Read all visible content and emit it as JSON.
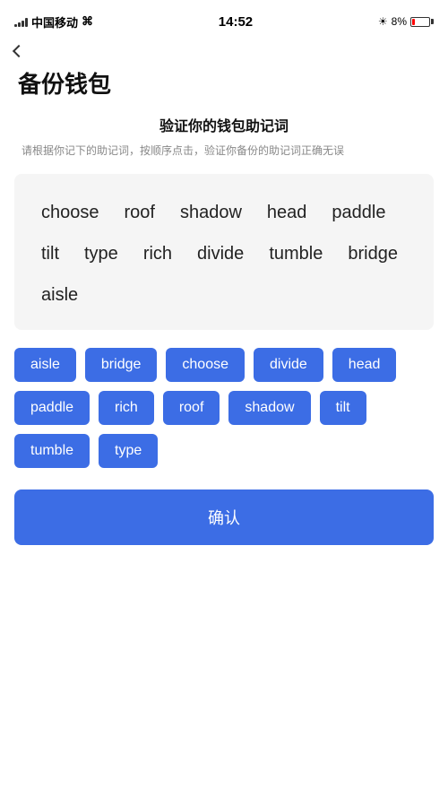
{
  "statusBar": {
    "carrier": "中国移动",
    "time": "14:52",
    "batteryPercent": "8%"
  },
  "header": {
    "backLabel": "",
    "title": "备份钱包"
  },
  "verify": {
    "sectionTitle": "验证你的钱包助记词",
    "sectionDesc": "请根据你记下的助记词，按顺序点击，验证你备份的助记词正确无误"
  },
  "displayWords": [
    "choose",
    "roof",
    "shadow",
    "head",
    "paddle",
    "tilt",
    "type",
    "rich",
    "divide",
    "tumble",
    "bridge",
    "aisle"
  ],
  "buttonWords": [
    "aisle",
    "bridge",
    "choose",
    "divide",
    "head",
    "paddle",
    "rich",
    "roof",
    "shadow",
    "tilt",
    "tumble",
    "type"
  ],
  "confirmButton": {
    "label": "确认"
  }
}
